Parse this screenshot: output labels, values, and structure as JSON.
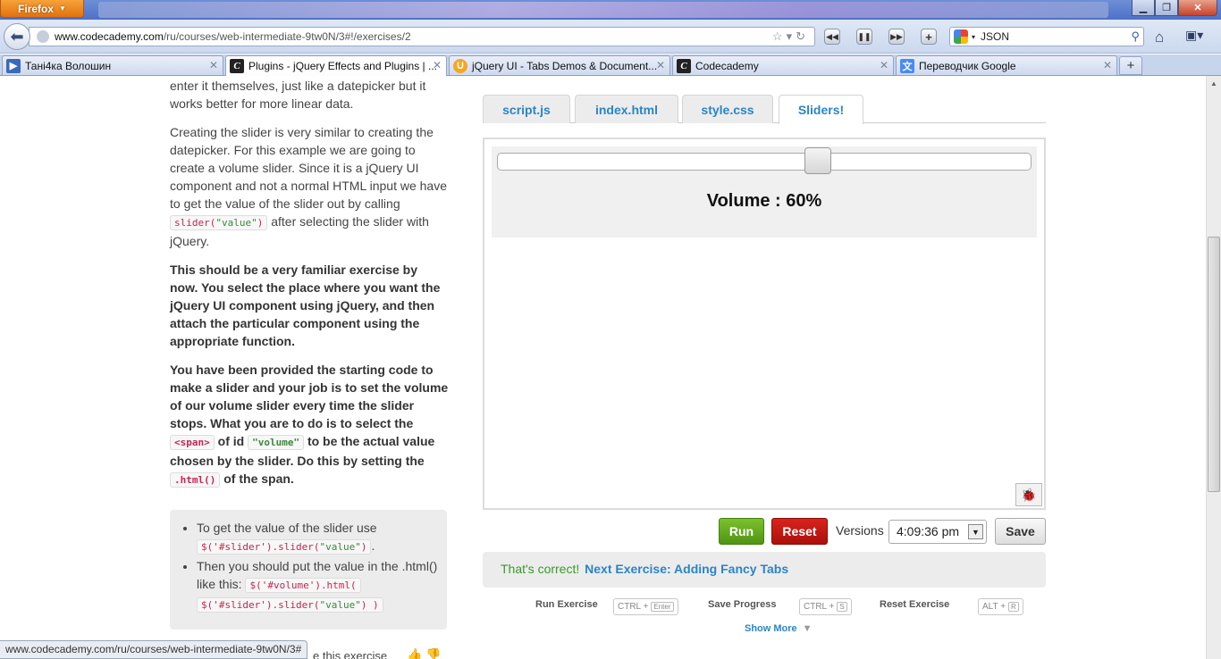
{
  "browser": {
    "menu_button": "Firefox",
    "url_host": "www.codecademy.com",
    "url_path": "/ru/courses/web-intermediate-9tw0N/3#!/exercises/2",
    "search_value": "JSON",
    "status_url": "www.codecademy.com/ru/courses/web-intermediate-9tw0N/3#",
    "tabs": [
      {
        "title": "Тані4ка Волошин",
        "favicon": "play-icon"
      },
      {
        "title": "Plugins - jQuery Effects and Plugins | ...",
        "favicon": "codecademy-icon"
      },
      {
        "title": "jQuery UI - Tabs Demos & Document...",
        "favicon": "jquery-icon"
      },
      {
        "title": "Codecademy",
        "favicon": "codecademy-icon"
      },
      {
        "title": "Переводчик Google",
        "favicon": "google-translate-icon"
      }
    ]
  },
  "instructions": {
    "p1": "enter it themselves, just like a datepicker but it works better for more linear data.",
    "p2_before": "Creating the slider is very similar to creating the datepicker. For this example we are going to create a volume slider. Since it is a jQuery UI component and not a normal HTML input we have to get the value of the slider out by calling",
    "p2_code_fn": "slider(",
    "p2_code_str": "\"value\"",
    "p2_code_end": ")",
    "p2_after": "after selecting the slider with jQuery.",
    "p3": "This should be a very familiar exercise by now. You select the place where you want the jQuery UI component using jQuery, and then attach the particular component using the appropriate function.",
    "p4_a": "You have been provided the starting code to make a slider and your job is to set the volume of our volume slider every time the slider stops. What you are to do is to select the",
    "p4_code_span": "<span>",
    "p4_b": "of id",
    "p4_code_id": "\"volume\"",
    "p4_c": "to be the actual value chosen by the slider. Do this by setting the",
    "p4_code_html": ".html()",
    "p4_d": "of the span."
  },
  "hints": {
    "h1_text": "To get the value of the slider use",
    "h1_code_a": "$('#slider').slider(",
    "h1_code_str": "\"value\"",
    "h1_code_b": ")",
    "h2_text": "Then you should put the value in the .html() like this:",
    "h2_code_a": "$('#volume').html(",
    "h2_code_b": "$('#slider').slider(",
    "h2_code_str": "\"value\"",
    "h2_code_c": ") )"
  },
  "editor": {
    "tabs": [
      "script.js",
      "index.html",
      "style.css",
      "Sliders!"
    ],
    "active_tab": "Sliders!"
  },
  "result": {
    "volume_label": "Volume : 60%",
    "volume_value": 60
  },
  "controls": {
    "run": "Run",
    "reset": "Reset",
    "versions_label": "Versions",
    "version_selected": "4:09:36 pm",
    "save": "Save"
  },
  "status": {
    "correct": "That's correct!",
    "next_exercise": "Next Exercise: Adding Fancy Tabs"
  },
  "shortcuts": [
    {
      "label": "Run Exercise",
      "mod": "CTRL +",
      "key": "Enter"
    },
    {
      "label": "Save Progress",
      "mod": "CTRL +",
      "key": "S"
    },
    {
      "label": "Reset Exercise",
      "mod": "ALT +",
      "key": "R"
    }
  ],
  "show_more": "Show More",
  "bottom_text": "e this exercise"
}
